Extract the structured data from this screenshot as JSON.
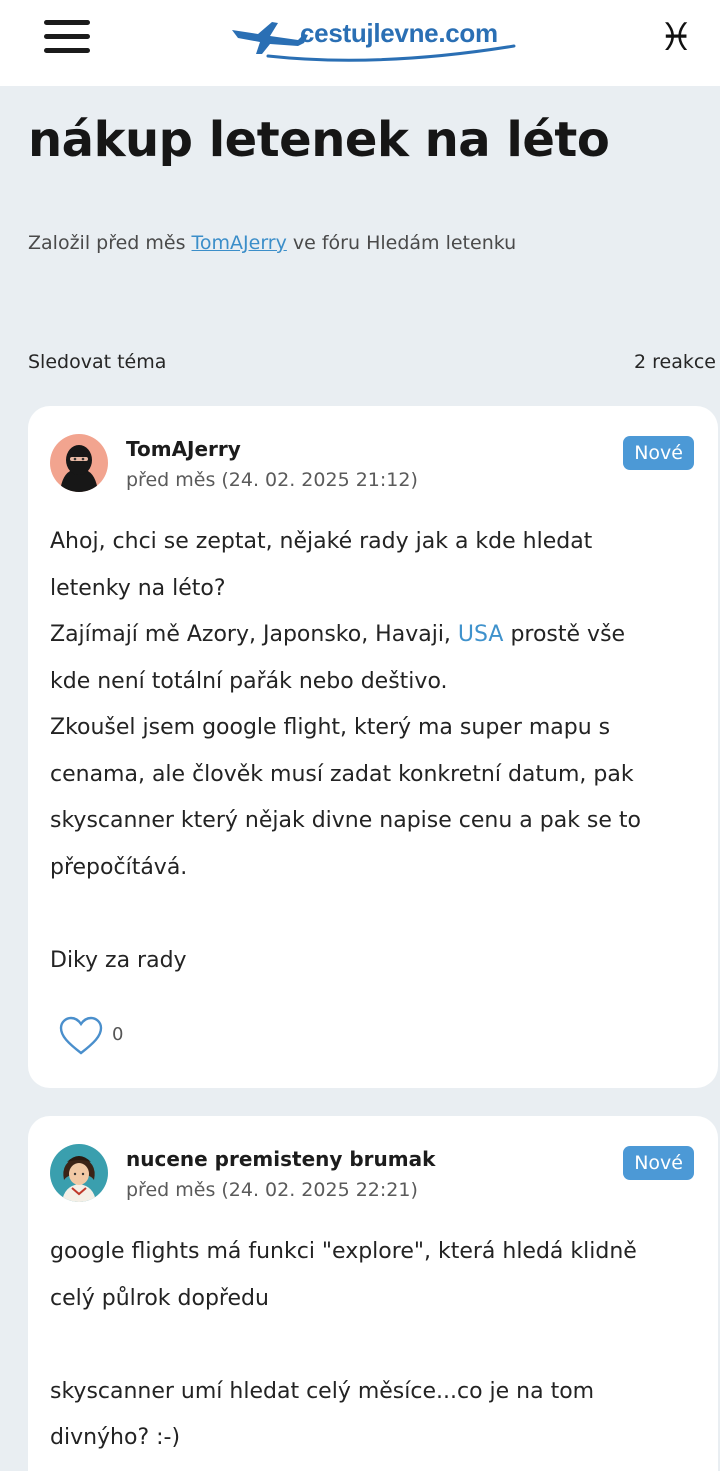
{
  "header": {
    "logo_text": "cestujlevne.com",
    "menu_icon": "hamburger-menu-icon",
    "user_icon": "pisces-zodiac-icon",
    "user_glyph": "♓"
  },
  "topic": {
    "title": "nákup letenek na léto",
    "meta_prefix": "Založil před měs ",
    "author_link": "TomAJerry",
    "meta_suffix": " ve fóru Hledám letenku",
    "follow_label": "Sledovat téma",
    "reaction_count": "2 reakce"
  },
  "posts": [
    {
      "author": "TomAJerry",
      "date": "před měs (24. 02. 2025 21:12)",
      "badge": "Nové",
      "lines": [
        "Ahoj,  chci se zeptat, nějaké rady jak a kde hledat",
        "letenky na léto?",
        "Zajímají mě Azory, Japonsko, Havaji, ",
        "USA",
        " prostě vše",
        "kde není totální pařák nebo deštivo.",
        "Zkoušel jsem google flight, který ma super mapu s",
        "cenama, ale člověk musí zadat konkretní datum, pak",
        "skyscanner který nějak divne napise cenu a pak se to",
        "přepočítává.",
        "Diky za rady"
      ],
      "likes": "0"
    },
    {
      "author": "nucene premisteny brumak",
      "date": "před měs (24. 02. 2025 22:21)",
      "badge": "Nové",
      "lines": [
        "google flights má funkci \"explore\", která hledá klidně",
        "celý půlrok dopředu",
        "skyscanner umí hledat celý měsíce...co je na tom",
        "divnýho? :-)"
      ]
    }
  ],
  "colors": {
    "link": "#3b8ec9",
    "badge": "#4c99d6",
    "page_bg": "#e9eef2"
  }
}
